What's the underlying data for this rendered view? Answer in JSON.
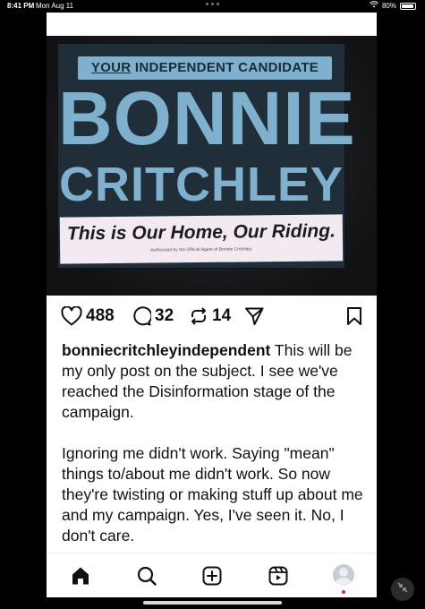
{
  "status_bar": {
    "time": "8:41 PM",
    "date": "Mon Aug 11",
    "battery": "80%",
    "battery_level": 0.8,
    "wifi_icon": "wifi-icon"
  },
  "post": {
    "image": {
      "sign_header_your": "YOUR",
      "sign_header_rest": "INDEPENDENT CANDIDATE",
      "sign_first_name": "BONNIE",
      "sign_last_name": "CRITCHLEY",
      "sign_slogan": "This is Our Home, Our Riding.",
      "sign_authorization": "Authorized by the Official Agent of Bonnie Critchley.",
      "sign_color": "#7fb0cd",
      "sign_background": "#1f2e38"
    },
    "actions": {
      "likes": "488",
      "comments": "32",
      "reposts": "14",
      "icons": [
        "heart-icon",
        "comment-icon",
        "repost-icon",
        "share-icon",
        "bookmark-icon"
      ]
    },
    "caption": {
      "username": "bonniecritchleyindependent",
      "paragraph1": " This will be my only post on the subject. I see we've reached the Disinformation stage of the campaign.",
      "paragraph2": "Ignoring me didn't work. Saying \"mean\" things to/about me didn't work. So now they're twisting or making stuff up about me and my campaign. Yes, I've seen it. No, I don't care."
    }
  },
  "bottom_nav": {
    "icons": [
      "home-icon",
      "search-icon",
      "create-icon",
      "reels-icon",
      "profile-avatar"
    ]
  }
}
